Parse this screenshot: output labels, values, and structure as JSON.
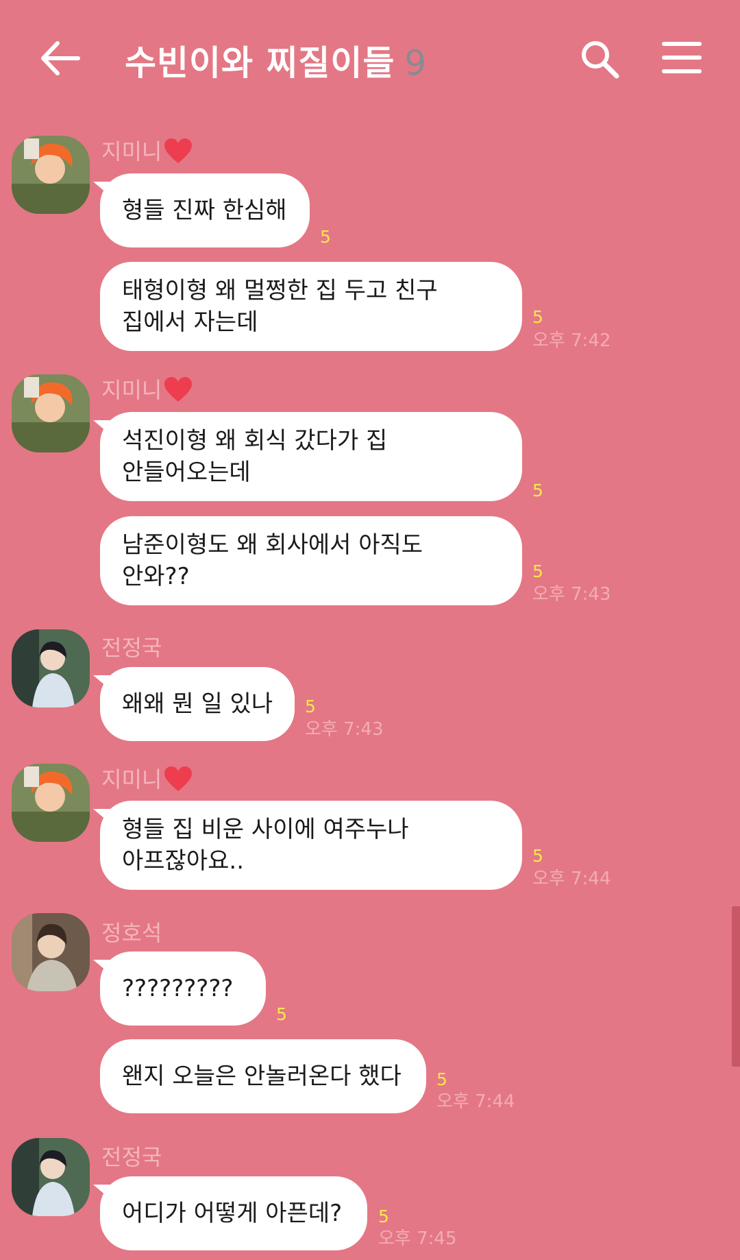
{
  "header": {
    "title": "수빈이와 찌질이들",
    "member_count": "9"
  },
  "senders": {
    "jimin": "지미니",
    "jungkook": "전정국",
    "hoseok": "정호석"
  },
  "messages": [
    {
      "lines": [
        "형들 진짜 한심해"
      ],
      "unread": "5",
      "time": ""
    },
    {
      "lines": [
        "태형이형 왜 멀쩡한 집 두고 친구",
        "집에서 자는데"
      ],
      "unread": "5",
      "time": "오후 7:42"
    },
    {
      "lines": [
        "석진이형 왜 회식 갔다가 집",
        "안들어오는데"
      ],
      "unread": "5",
      "time": ""
    },
    {
      "lines": [
        "남준이형도 왜 회사에서 아직도",
        "안와??"
      ],
      "unread": "5",
      "time": "오후 7:43"
    },
    {
      "lines": [
        "왜왜 뭔 일 있나"
      ],
      "unread": "5",
      "time": "오후 7:43"
    },
    {
      "lines": [
        "형들 집 비운 사이에 여주누나",
        "아프잖아요.."
      ],
      "unread": "5",
      "time": "오후 7:44"
    },
    {
      "lines": [
        "?????????"
      ],
      "unread": "5",
      "time": ""
    },
    {
      "lines": [
        "왠지 오늘은 안놀러온다 했다"
      ],
      "unread": "5",
      "time": "오후 7:44"
    },
    {
      "lines": [
        "어디가 어떻게 아픈데?"
      ],
      "unread": "5",
      "time": "오후 7:45"
    }
  ],
  "colors": {
    "background": "#e47785",
    "bubble": "#ffffff",
    "unread": "#f7e94e",
    "meta_text": "#f2adb5",
    "name_text": "#f4b6bd"
  },
  "icons": {
    "back": "arrow-left-icon",
    "search": "search-icon",
    "menu": "hamburger-menu-icon",
    "heart": "heart-icon"
  }
}
